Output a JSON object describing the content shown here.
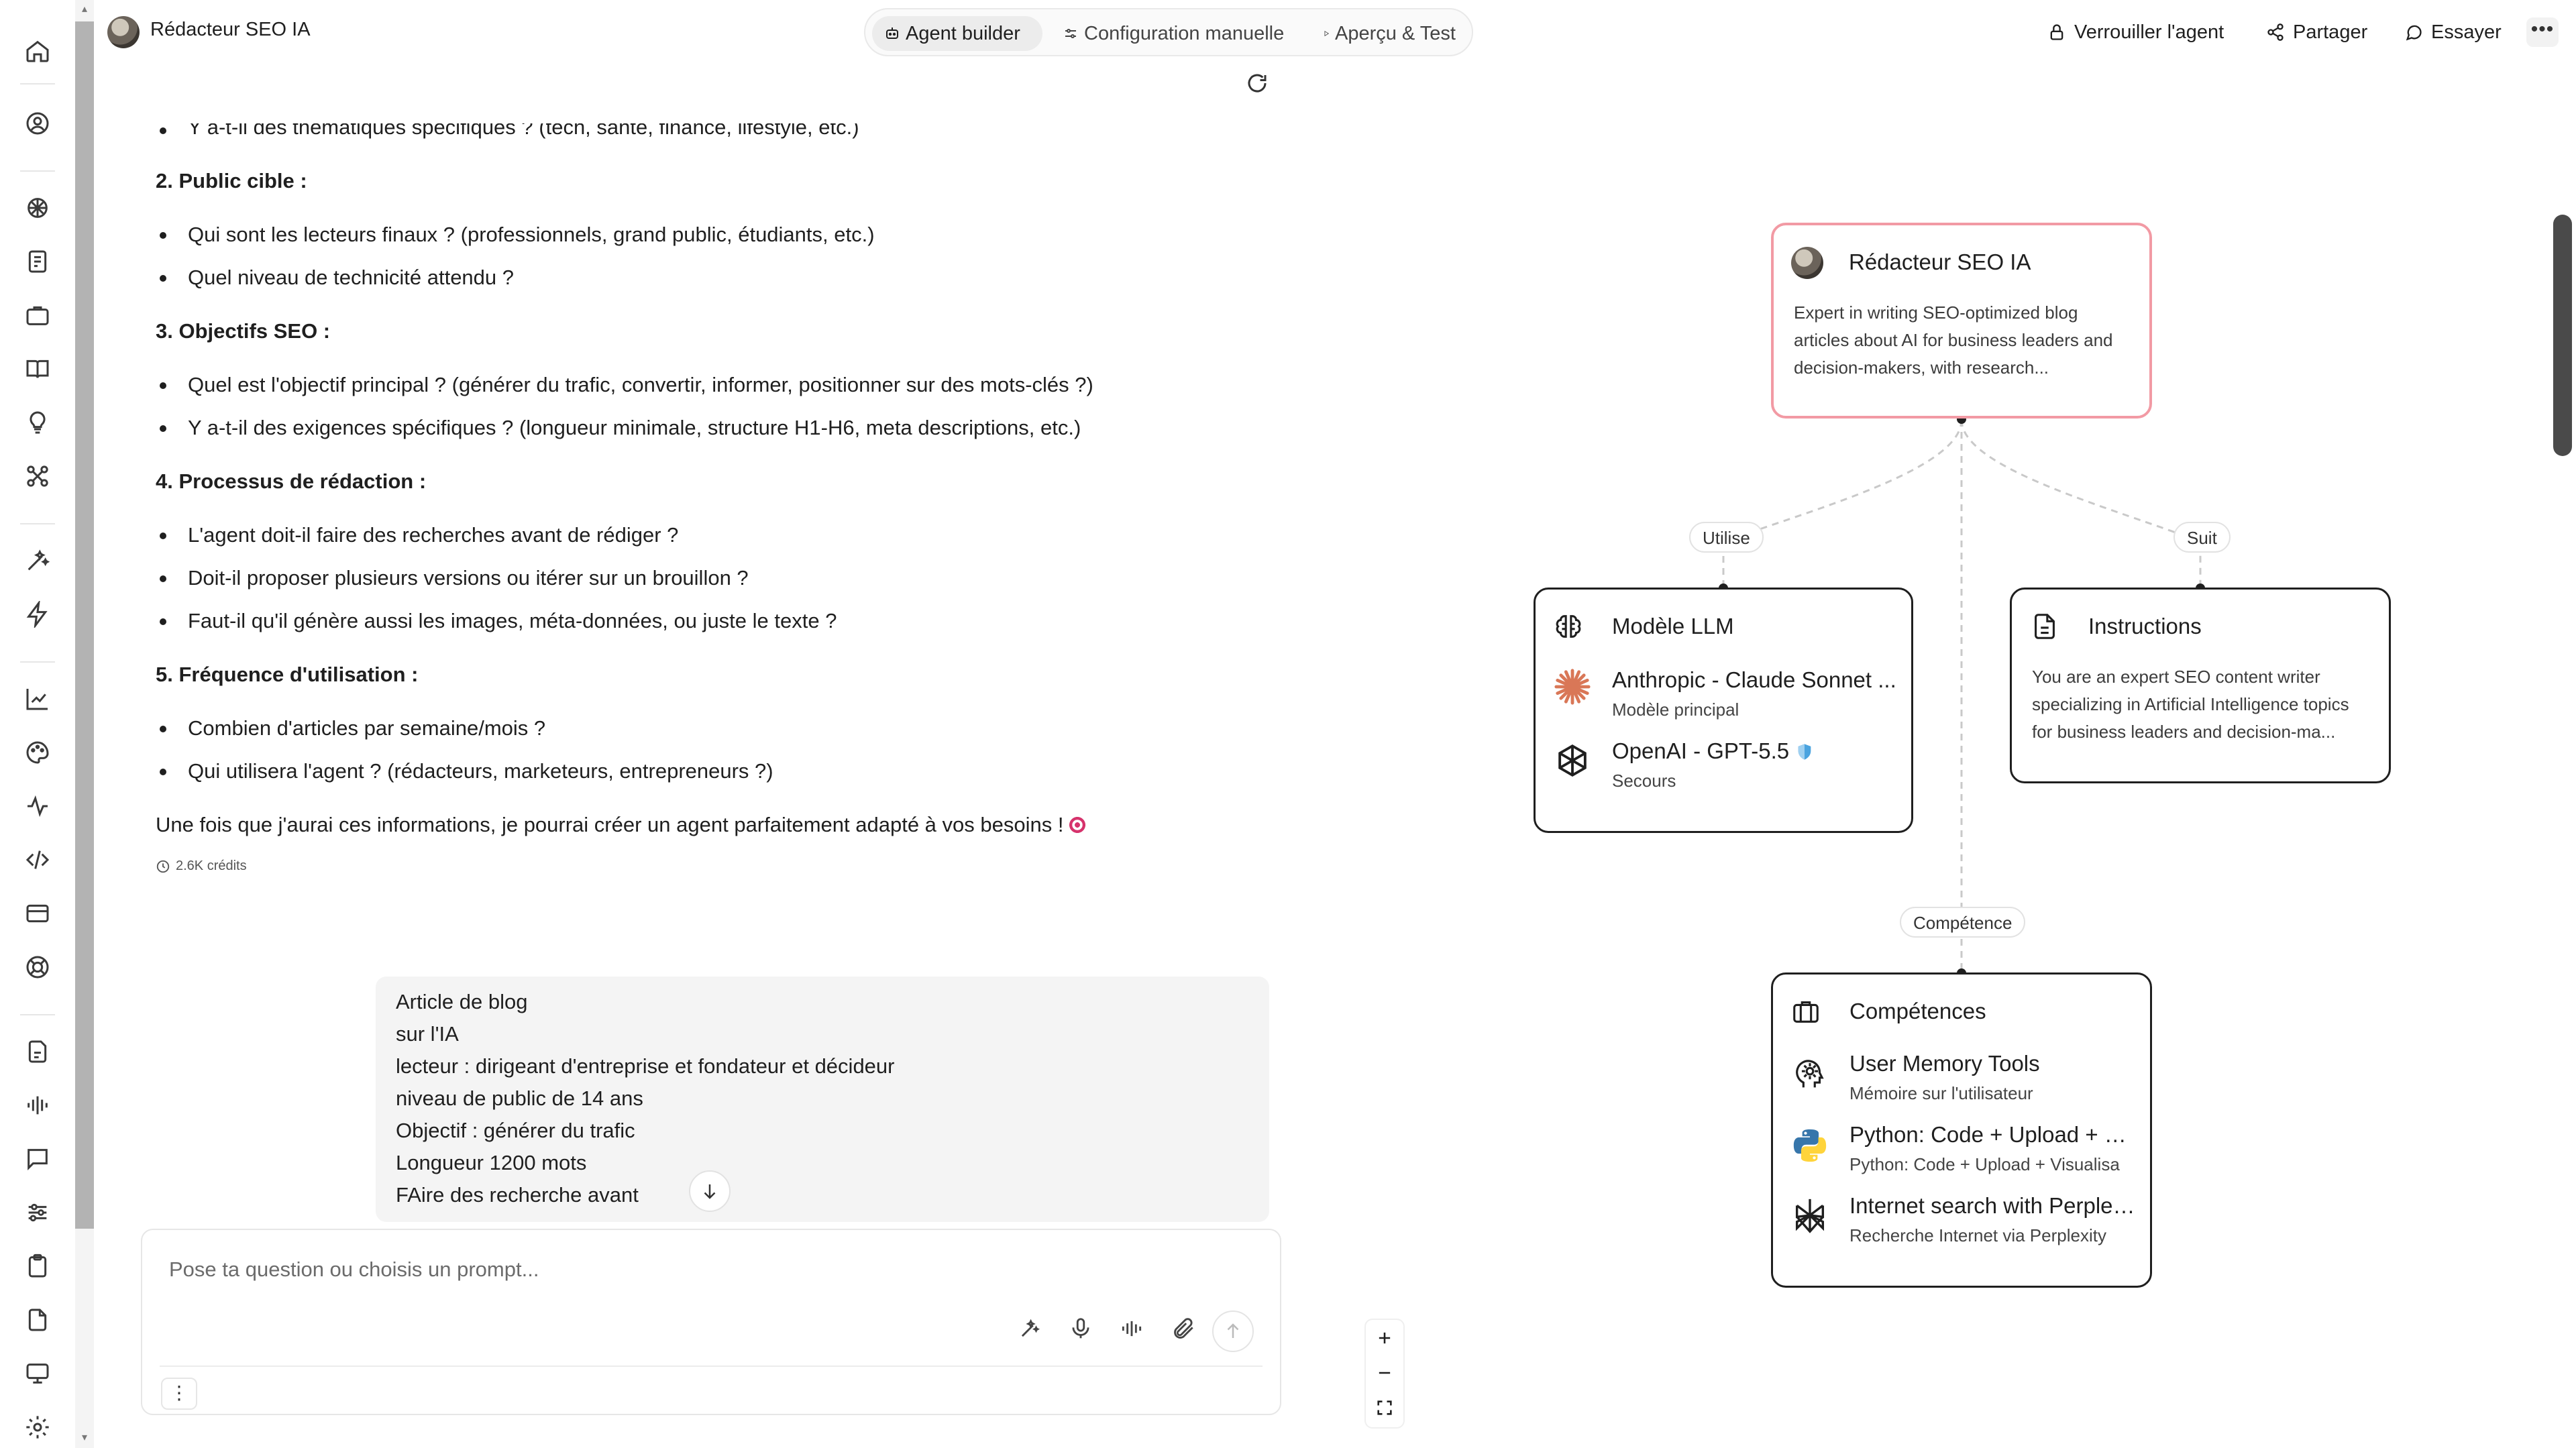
{
  "app": {
    "agent_name": "Rédacteur SEO IA"
  },
  "view_tabs": [
    {
      "label": "Agent builder",
      "icon": "robot-icon",
      "active": true
    },
    {
      "label": "Configuration manuelle",
      "icon": "sliders-icon",
      "active": false
    },
    {
      "label": "Aperçu & Test",
      "icon": "play-icon",
      "active": false
    }
  ],
  "top_actions": {
    "lock": "Verrouiller l'agent",
    "share": "Partager",
    "try": "Essayer",
    "more": "•••"
  },
  "sidebar_icons": [
    "home-icon",
    "user-icon",
    "brain-icon",
    "notes-icon",
    "briefcase-icon",
    "book-icon",
    "bulb-icon",
    "integrations-icon",
    "magic-icon",
    "bolt-icon",
    "chart-icon",
    "palette-icon",
    "activity-icon",
    "code-icon",
    "card-icon",
    "support-icon",
    "documents-icon",
    "audio-icon",
    "chat-icon",
    "settings-sliders-icon",
    "clipboard-icon",
    "file-icon",
    "monitor-icon",
    "gear-icon"
  ],
  "chat": {
    "cut_line": "Y a-t-il des thématiques spécifiques ? (tech, santé, finance, lifestyle, etc.)",
    "sections": [
      {
        "heading": "2. Public cible :",
        "bullets": [
          "Qui sont les lecteurs finaux ? (professionnels, grand public, étudiants, etc.)",
          "Quel niveau de technicité attendu ?"
        ]
      },
      {
        "heading": "3. Objectifs SEO :",
        "bullets": [
          "Quel est l'objectif principal ? (générer du trafic, convertir, informer, positionner sur des mots-clés ?)",
          "Y a-t-il des exigences spécifiques ? (longueur minimale, structure H1-H6, meta descriptions, etc.)"
        ]
      },
      {
        "heading": "4. Processus de rédaction :",
        "bullets": [
          "L'agent doit-il faire des recherches avant de rédiger ?",
          "Doit-il proposer plusieurs versions ou itérer sur un brouillon ?",
          "Faut-il qu'il génère aussi les images, méta-données, ou juste le texte ?"
        ]
      },
      {
        "heading": "5. Fréquence d'utilisation :",
        "bullets": [
          "Combien d'articles par semaine/mois ?",
          "Qui utilisera l'agent ? (rédacteurs, marketeurs, entrepreneurs ?)"
        ]
      }
    ],
    "closing": "Une fois que j'aurai ces informations, je pourrai créer un agent parfaitement adapté à vos besoins !",
    "credits": "2.6K crédits",
    "user_message_lines": [
      "Article de blog",
      "sur l'IA",
      "lecteur : dirigeant d'entreprise et fondateur et décideur",
      "niveau de public de 14 ans",
      "Objectif : générer du trafic",
      "Longueur 1200 mots",
      "FAire des recherche avant"
    ]
  },
  "composer": {
    "placeholder": "Pose ta question ou choisis un prompt...",
    "value": "",
    "menu": "⋮"
  },
  "graph": {
    "agent": {
      "title": "Rédacteur SEO IA",
      "description": "Expert in writing SEO-optimized blog articles about AI for business leaders and decision-makers, with research..."
    },
    "edge_labels": {
      "uses": "Utilise",
      "follows": "Suit",
      "skill": "Compétence"
    },
    "llm": {
      "title": "Modèle LLM",
      "primary": {
        "name": "Anthropic - Claude Sonnet ...",
        "role": "Modèle principal"
      },
      "fallback": {
        "name": "OpenAI - GPT-5.5",
        "role": "Secours"
      }
    },
    "instructions": {
      "title": "Instructions",
      "text": "You are an expert SEO content writer specializing in Artificial Intelligence topics for business leaders and decision-ma..."
    },
    "skills": {
      "title": "Compétences",
      "items": [
        {
          "name": "User Memory Tools",
          "sub": "Mémoire sur l'utilisateur",
          "icon": "brain-memory-icon"
        },
        {
          "name": "Python: Code + Upload + Vi...",
          "sub": "Python: Code + Upload + Visualisa",
          "icon": "python-icon"
        },
        {
          "name": "Internet search with Perplexity",
          "sub": "Recherche Internet via Perplexity",
          "icon": "perplexity-icon"
        }
      ]
    }
  },
  "colors": {
    "agent_border": "#f29aa4",
    "claude_orange": "#d97757",
    "python_blue": "#3776ab",
    "python_yellow": "#ffd43b",
    "shield_blue": "#4aa3df"
  }
}
